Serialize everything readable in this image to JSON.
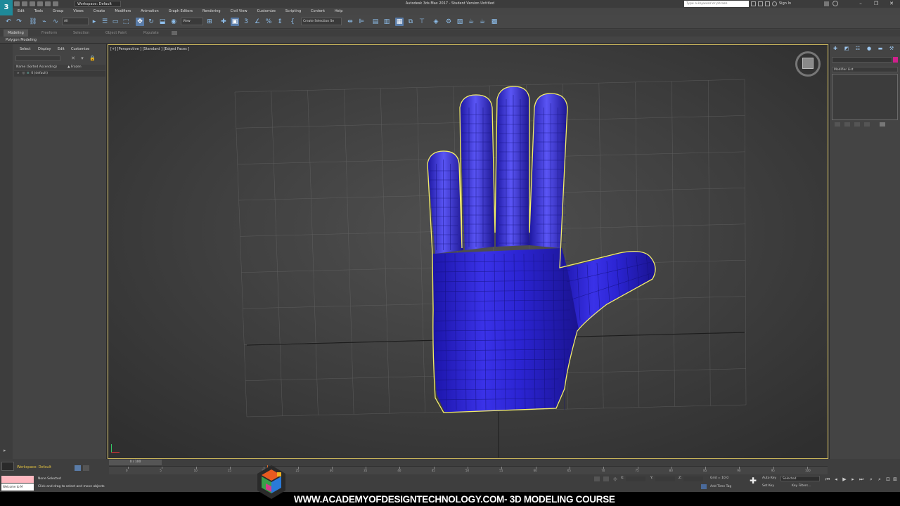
{
  "title_bar": {
    "workspace_tab": "Workspace: Default",
    "window_title": "Autodesk 3ds Max 2017 - Student Version   Untitled",
    "search_placeholder": "Type a keyword or phrase",
    "sign_in": "Sign In"
  },
  "menu": [
    "Edit",
    "Tools",
    "Group",
    "Views",
    "Create",
    "Modifiers",
    "Animation",
    "Graph Editors",
    "Rendering",
    "Civil View",
    "Customize",
    "Scripting",
    "Content",
    "Help"
  ],
  "toolbar": {
    "filter_dropdown": "All",
    "view_dropdown": "View",
    "selection_set_dropdown": "Create Selection Se"
  },
  "ribbon": {
    "tabs": [
      "Modeling",
      "Freeform",
      "Selection",
      "Object Paint",
      "Populate"
    ],
    "panel_label": "Polygon Modeling"
  },
  "scene_explorer": {
    "tabs": [
      "Select",
      "Display",
      "Edit",
      "Customize"
    ],
    "column_name": "Name (Sorted Ascending)",
    "column_frozen": "▲ Frozen",
    "layer_row": "0 (default)"
  },
  "viewport": {
    "label": "[+] [Perspective ] [Standard ] [Edged Faces ]",
    "object_color": "#2a22d6",
    "selection_color": "#f2ec6a"
  },
  "command_panel": {
    "modifier_list": "Modifier List",
    "color_swatch": "#d0208c"
  },
  "timeline": {
    "slider": "0 / 100",
    "ticks": [
      "0",
      "5",
      "10",
      "15",
      "20",
      "25",
      "30",
      "35",
      "40",
      "45",
      "50",
      "55",
      "60",
      "65",
      "70",
      "75",
      "80",
      "85",
      "90",
      "95",
      "100"
    ]
  },
  "status": {
    "workspace": "Workspace: Default",
    "welcome": "Welcome to M",
    "line1": "None Selected",
    "line2": "Click and drag to select and move objects",
    "x_label": "X:",
    "y_label": "Y:",
    "z_label": "Z:",
    "grid": "Grid = 10.0",
    "add_time_tag": "Add Time Tag",
    "auto_key": "Auto Key",
    "set_key": "Set Key",
    "selected": "Selected",
    "key_filters": "Key Filters..."
  },
  "banner": {
    "text": "WWW.ACADEMYOFDESIGNTECHNOLOGY.COM- 3D MODELING COURSE"
  }
}
